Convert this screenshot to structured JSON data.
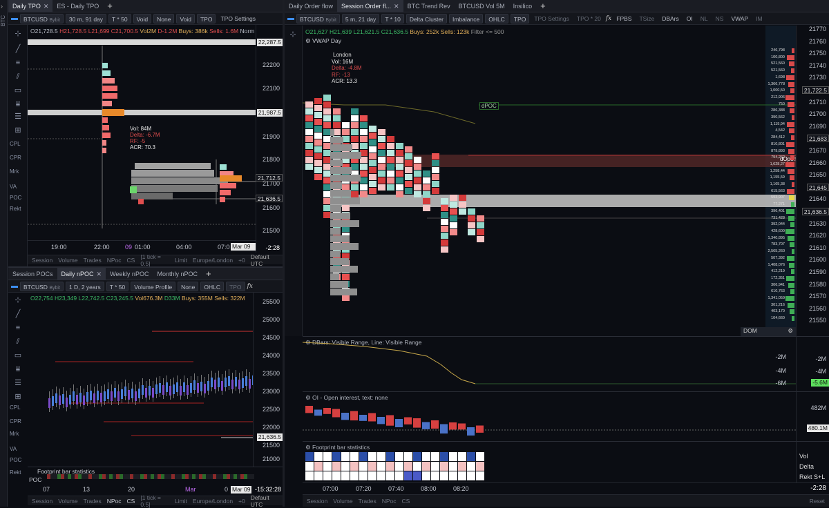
{
  "sidebar": {
    "label": "BTC"
  },
  "top_left": {
    "tabs": [
      {
        "label": "Daily TPO",
        "close": "✕"
      },
      {
        "label": "ES - Daily TPO"
      },
      {
        "label": "+"
      }
    ],
    "toolbar": {
      "symbol": "BTCUSD",
      "exchange": "Bybit",
      "tf": "30 m, 91 day",
      "mult": "T * 50",
      "b1": "Void",
      "b2": "None",
      "b3": "Void",
      "b4": "TPO",
      "b5": "TPO Settings"
    },
    "ohlc": {
      "o": "O21,728.5",
      "h": "H21,728.5",
      "l": "L21,699",
      "c": "C21,700.5",
      "vol": "Vol2M",
      "d": "D-1.2M",
      "buys": "Buys: 386k",
      "sells": "Sells: 1.6M",
      "norm": "Norm"
    },
    "yticks": [
      "22,287.5",
      "22200",
      "22100",
      "21,987.5",
      "21900",
      "21800",
      "21700",
      "21,712.5",
      "21,636.5",
      "21600",
      "21500"
    ],
    "xticks": [
      "19:00",
      "22:00",
      "09",
      "01:00",
      "04:00",
      "07:0"
    ],
    "date_badge": "Mar 09 0",
    "countdown": "-2:28",
    "info": {
      "vol": "Vol: 84M",
      "delta": "Delta: -6.7M",
      "rf": "RF: -5",
      "acr": "ACR: 70.3"
    },
    "footer": [
      "Session",
      "Volume",
      "Trades",
      "NPoc",
      "CS",
      "[1 tick = 0.5]",
      "Limit",
      "Europe/London",
      "+0"
    ],
    "footer_right": "Default UTC"
  },
  "bottom_left": {
    "tabs": [
      {
        "label": "Session POCs"
      },
      {
        "label": "Daily nPOC",
        "close": "✕"
      },
      {
        "label": "Weekly nPOC"
      },
      {
        "label": "Monthly nPOC"
      },
      {
        "label": "+"
      }
    ],
    "toolbar": {
      "symbol": "BTCUSD",
      "exchange": "Bybit",
      "tf": "1 D, 2 years",
      "mult": "T * 50",
      "b1": "Volume Profile",
      "b2": "None",
      "b3": "OHLC",
      "b4": "TPO"
    },
    "ohlc": {
      "o": "O22,754",
      "h": "H23,349",
      "l": "L22,742.5",
      "c": "C23,245.5",
      "vol": "Vol676.3M",
      "d": "D33M",
      "buys": "Buys: 355M",
      "sells": "Sells: 322M"
    },
    "yticks": [
      "25500",
      "25000",
      "24500",
      "24000",
      "23500",
      "23000",
      "22500",
      "22000",
      "21,636.5",
      "21500",
      "21000"
    ],
    "xticks": [
      "07",
      "13",
      "20",
      "Mar",
      "0"
    ],
    "date_badge": "Mar 09",
    "countdown": "-15:32:28",
    "stats_title": "Footprint bar statistics",
    "stats_row": "POC",
    "footer": [
      "Session",
      "Volume",
      "Trades",
      "NPoc",
      "CS",
      "[1 tick = 0.5]",
      "Limit",
      "Europe/London",
      "+0"
    ],
    "footer_right": "Default UTC"
  },
  "left_tools": [
    "CPL",
    "CPR",
    "Mrk",
    "VA",
    "POC",
    "Rekt"
  ],
  "right": {
    "tabs": [
      {
        "label": "Daily Order flow"
      },
      {
        "label": "Session Order fl...",
        "close": "✕"
      },
      {
        "label": "BTC Trend Rev"
      },
      {
        "label": "BTCUSD Vol 5M"
      },
      {
        "label": "Insilico"
      },
      {
        "label": "+"
      }
    ],
    "toolbar": {
      "symbol": "BTCUSD",
      "exchange": "Bybit",
      "tf": "5 m, 21 day",
      "mult": "T * 10",
      "b1": "Delta Cluster",
      "b2": "Imbalance",
      "b3": "OHLC",
      "b4": "TPO",
      "b5": "TPO Settings",
      "b6": "TPO * 20",
      "items": [
        "FPBS",
        "TSize",
        "DBArs",
        "OI",
        "NL",
        "NS",
        "VWAP",
        "IM"
      ]
    },
    "ohlc": {
      "o": "O21,627",
      "h": "H21,639",
      "l": "L21,621.5",
      "c": "C21,636.5",
      "buys": "Buys: 252k",
      "sells": "Sells: 123k",
      "filter": "Filter <= 500"
    },
    "vwap_label": "VWAP Day",
    "session": {
      "name": "London",
      "vol": "Vol: 16M",
      "delta": "Delta: -4.8M",
      "rf": "RF: -13",
      "acr": "ACR: 13.3"
    },
    "dpoc": "dPOC",
    "dopen": "dOpen",
    "yticks": [
      "21770",
      "21760",
      "21750",
      "21740",
      "21730",
      "21,722.5",
      "21710",
      "21700",
      "21690",
      "21,683",
      "21670",
      "21660",
      "21650",
      "21,645",
      "21640",
      "21,636.5",
      "21630",
      "21620",
      "21610",
      "21600",
      "21590",
      "21580",
      "21570",
      "21560",
      "21550"
    ],
    "dom_values": [
      "246,798",
      "100,800",
      "521,560",
      "521,560",
      "1,698",
      "1,366,778",
      "1,000,50",
      "212,906",
      "750",
      "286,388",
      "390,562",
      "1,119,94",
      "4,542",
      "284,412",
      "810,801",
      "879,893",
      "794,262",
      "1,628,27",
      "1,258,44",
      "1,155,59",
      "1,165,38",
      "615,563",
      "593,907",
      "77,271",
      "396,401",
      "731,428",
      "392,044",
      "428,600",
      "1,340,895",
      "783,707",
      "2,565,260",
      "507,392",
      "1,408,076",
      "412,219",
      "172,351",
      "306,941",
      "610,763",
      "1,341,059",
      "301,216",
      "403,170",
      "104,660"
    ],
    "dom_label": "DOM",
    "dbars_title": "DBars: Visible Range, Line: Visible Range",
    "dbars_ticks": [
      "-2M",
      "-4M",
      "-5.6M"
    ],
    "dbars_inner": [
      "-2M",
      "-4M",
      "-6M"
    ],
    "oi_title": "OI - Open interest, text: none",
    "oi_ticks": [
      "482M",
      "480.1M"
    ],
    "fp_title": "Footprint bar statistics",
    "fp_labels": [
      "Vol",
      "Delta",
      "Rekt S+L"
    ],
    "xticks": [
      "07:00",
      "07:20",
      "07:40",
      "08:00",
      "08:20"
    ],
    "countdown": "-2:28",
    "footer": [
      "Session",
      "Volume",
      "Trades",
      "NPoc",
      "CS"
    ],
    "footer_right": "Reset"
  }
}
